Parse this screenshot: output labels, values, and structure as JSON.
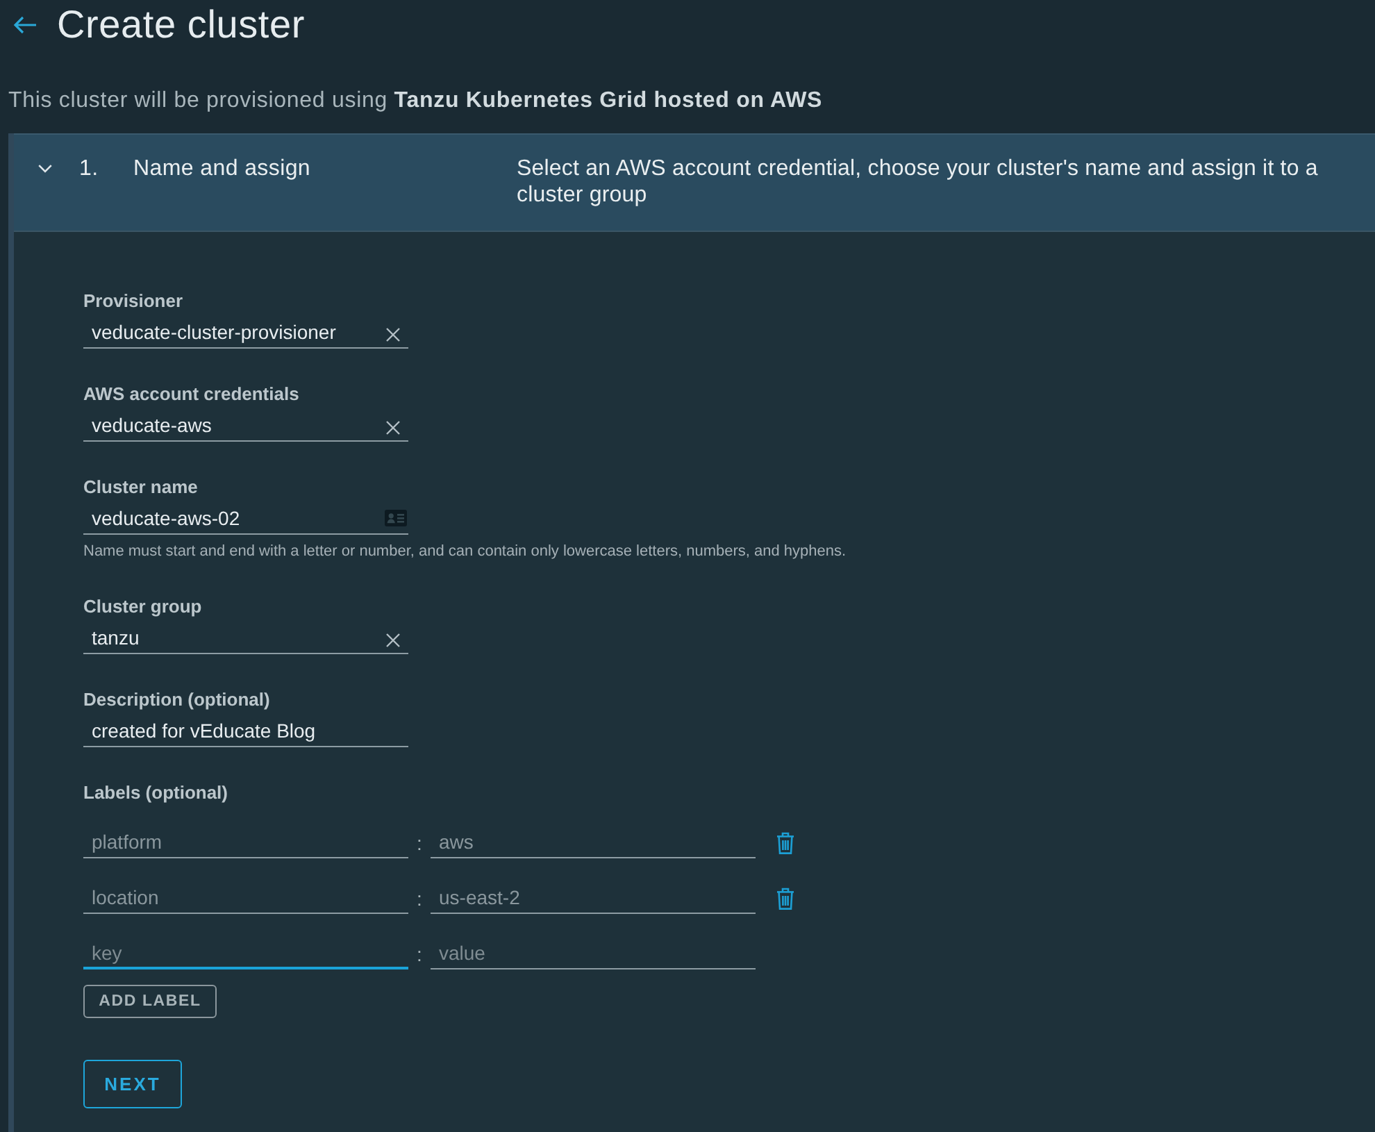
{
  "header": {
    "title": "Create cluster"
  },
  "provisioning_note": "This cluster will be provisioned using **Tanzu Kubernetes Grid hosted on AWS**",
  "step": {
    "number": "1.",
    "title": "Name and assign",
    "description": "Select an AWS account credential, choose your cluster's name and assign it to a cluster group",
    "expanded": true
  },
  "fields": [
    {
      "kind": "select",
      "label": "Provisioner",
      "value": "veducate-cluster-provisioner"
    },
    {
      "kind": "select",
      "label": "AWS account credentials",
      "value": "veducate-aws"
    },
    {
      "kind": "name",
      "label": "Cluster name",
      "value": "veducate-aws-02",
      "helper": "Name must start and end with a letter or number, and can contain only lowercase letters, numbers, and hyphens."
    },
    {
      "kind": "select",
      "label": "Cluster group",
      "value": "tanzu"
    },
    {
      "kind": "text",
      "label": "Description (optional)",
      "value": "created for vEducate Blog"
    }
  ],
  "labels": {
    "title": "Labels (optional)",
    "rows": [
      {
        "key": {
          "value": "platform",
          "focused": false
        },
        "separator": ":",
        "value": {
          "value": "aws",
          "focused": false
        },
        "disabled": true,
        "removable": true
      },
      {
        "key": {
          "value": "location",
          "focused": false
        },
        "separator": ":",
        "value": {
          "value": "us-east-2",
          "focused": false
        },
        "disabled": true,
        "removable": true
      },
      {
        "key": {
          "placeholder": "key",
          "focused": true
        },
        "separator": ":",
        "value": {
          "placeholder": "value",
          "focused": false
        },
        "disabled": false,
        "removable": false
      }
    ],
    "add_button": "ADD LABEL"
  },
  "next_button": "NEXT"
}
